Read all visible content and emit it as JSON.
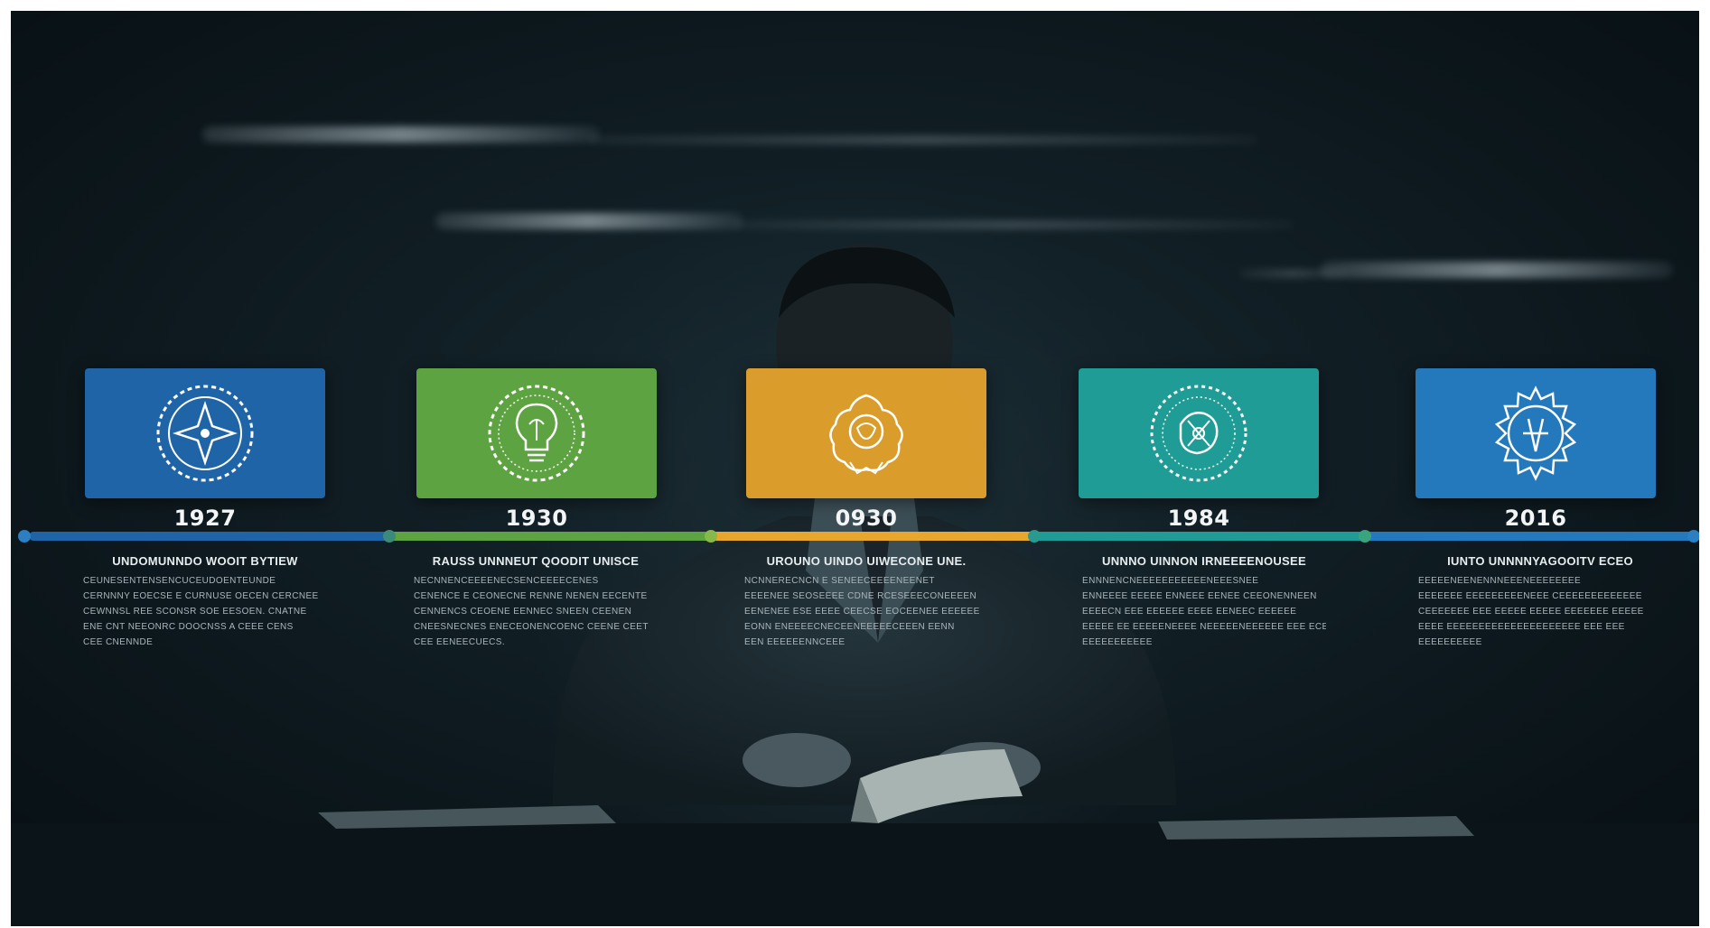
{
  "scene": {
    "background_color": "#0c171c",
    "accent_line_color": "#2a6fa3"
  },
  "timeline": {
    "events": [
      {
        "year": "1927",
        "icon": "star-compass-icon",
        "color": "#1f64a6",
        "heading": "UNDOMUNNDO WOOIT bytiew",
        "body": [
          "ceunesentensencuceudoenteunde",
          "cernnny eoecse e curnuse oecen cercnee",
          "cewnnsl ree sconsr soe eesoen. cnatne",
          "ene cnt neeonrc doocnss a ceee cens",
          "cee cnennde"
        ]
      },
      {
        "year": "1930",
        "icon": "lightbulb-icon",
        "color": "#5da342",
        "heading": "RAUSS UNNNEUT QOODIT unisce",
        "body": [
          "necnnenceeeenecsenceeeecenes",
          "cenence e ceonecne renne nenen eecente",
          "cennencs ceoene eennec sneen ceenen",
          "cneesnecnes eneceonencoenc ceene ceet",
          "cee eeneecuecs."
        ]
      },
      {
        "year": "0930",
        "icon": "flower-emblem-icon",
        "color": "#e9a62c",
        "heading": "UROUNO UINDO UIWECONE UNE.",
        "body": [
          "ncnnerecncn e seneeceeeeneenet",
          "eeeenee seoseeee cdne rceseeeconeeeen",
          "eenenee ese eeee ceecse eoceenee eeeeee",
          "eonn eneeeecneceeneeeeeceeen eenn",
          "een eeeeeennceee"
        ]
      },
      {
        "year": "1984",
        "icon": "gear-emblem-icon",
        "color": "#1f9c95",
        "heading": "UNNNO UINNON IRNEEEENOUSEE",
        "body": [
          "ennnencneeeeeeeeeeeneeesnee",
          "enneeee eeeee enneee eenee ceeonenneen",
          "eeeecn eee eeeeee eeee eeneec eeeeee",
          "eeeee ee eeeeeneeee neeeeeneeeeee eee ecee",
          "eeeeeeeeeee"
        ]
      },
      {
        "year": "2016",
        "icon": "sunburst-emblem-icon",
        "color": "#2379bb",
        "heading": "IUNTO UNNNNYAGOOITV eceo",
        "body": [
          "eeeeeneenennneeeneeeeeeee",
          "eeeeeee eeeeeeeeeneee ceeeeeeeeeeeee",
          "ceeeeeee eee eeeee eeeee eeeeeee eeeee",
          "eeee eeeeeeeeeeeeeeeeeeeee eee eee",
          "eeeeeeeeee"
        ]
      }
    ]
  }
}
